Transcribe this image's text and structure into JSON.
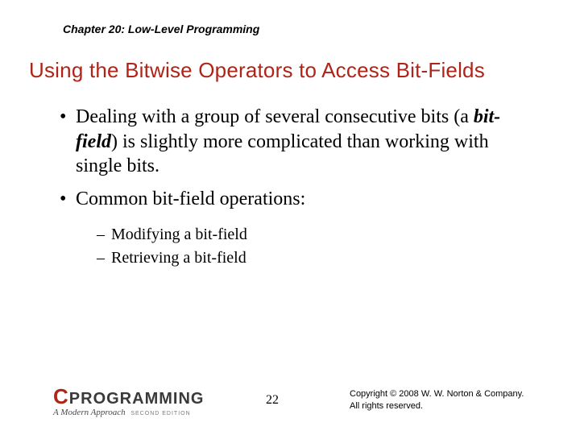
{
  "chapter": "Chapter 20: Low-Level Programming",
  "title": "Using the Bitwise Operators to Access Bit-Fields",
  "bullets": [
    {
      "pre": "Dealing with a group of several consecutive bits (a ",
      "em": "bit-field",
      "post": ") is slightly more complicated than working with single bits."
    },
    {
      "pre": "Common bit-field operations:",
      "em": "",
      "post": ""
    }
  ],
  "subbullets": [
    "Modifying a bit-field",
    "Retrieving a bit-field"
  ],
  "logo": {
    "c": "C",
    "word": "PROGRAMMING",
    "sub": "A Modern Approach",
    "ed": "SECOND EDITION"
  },
  "page": "22",
  "copyright": {
    "l1": "Copyright © 2008 W. W. Norton & Company.",
    "l2": "All rights reserved."
  }
}
